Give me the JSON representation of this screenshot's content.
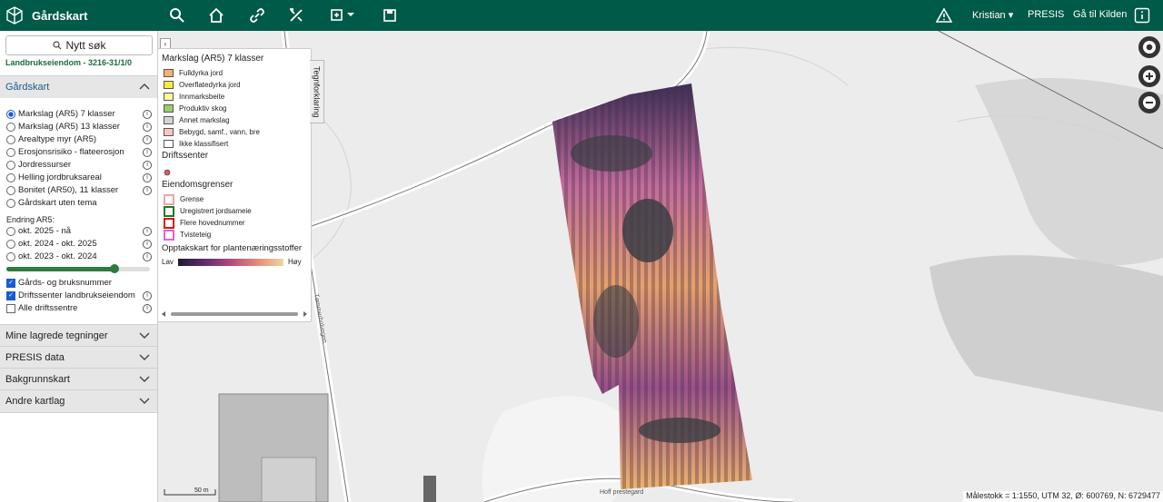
{
  "app": {
    "title": "Gårdskart"
  },
  "topbar": {
    "icons": [
      "search-icon",
      "home-icon",
      "link-icon",
      "tools-icon",
      "add-layer-icon",
      "save-icon"
    ],
    "warning_icon": "warning-icon",
    "user_label": "Kristian",
    "presis_label": "PRESIS",
    "kilden_label": "Gå til Kilden",
    "info_icon": "info-icon"
  },
  "sidebar": {
    "search_label": "Nytt søk",
    "property_label": "Landbrukseiendom - 3216-31/1/0",
    "gardskart_section": "Gårdskart",
    "themes": [
      {
        "label": "Markslag (AR5) 7 klasser",
        "selected": true
      },
      {
        "label": "Markslag (AR5) 13 klasser",
        "selected": false
      },
      {
        "label": "Arealtype myr (AR5)",
        "selected": false
      },
      {
        "label": "Erosjonsrisiko - flateerosjon",
        "selected": false
      },
      {
        "label": "Jordressurser",
        "selected": false
      },
      {
        "label": "Helling jordbruksareal",
        "selected": false
      },
      {
        "label": "Bonitet (AR50), 11 klasser",
        "selected": false
      },
      {
        "label": "Gårdskart uten tema",
        "selected": false
      }
    ],
    "endring_label": "Endring AR5:",
    "endring_options": [
      {
        "label": "okt. 2025 - nå",
        "selected": false
      },
      {
        "label": "okt. 2024 - okt. 2025",
        "selected": false
      },
      {
        "label": "okt. 2023 - okt. 2024",
        "selected": false
      }
    ],
    "slider_level": 0.75,
    "checkboxes": [
      {
        "label": "Gårds- og bruksnummer",
        "checked": true
      },
      {
        "label": "Driftssenter landbrukseiendom",
        "checked": true
      },
      {
        "label": "Alle driftssentre",
        "checked": false
      }
    ],
    "sections": [
      {
        "label": "Mine lagrede tegninger"
      },
      {
        "label": "PRESIS data"
      },
      {
        "label": "Bakgrunnskart"
      },
      {
        "label": "Andre kartlag"
      }
    ]
  },
  "legend": {
    "tab_label": "Tegnforklaring",
    "markslag_title": "Markslag (AR5) 7 klasser",
    "markslag_items": [
      {
        "label": "Fulldyrka jord",
        "color": "#f5b26b"
      },
      {
        "label": "Overflatedyrka jord",
        "color": "#ffea3a"
      },
      {
        "label": "Innmarksbeite",
        "color": "#fffaa0"
      },
      {
        "label": "Produktiv skog",
        "color": "#9acd6e"
      },
      {
        "label": "Annet markslag",
        "color": "#d4d4d4"
      },
      {
        "label": "Bebygd, samf., vann, bre",
        "color": "#f4c8c0"
      },
      {
        "label": "Ikke klassifisert",
        "color": "#ffffff"
      }
    ],
    "driftssenter_title": "Driftssenter",
    "driftssenter_color": "#e05a5a",
    "eiendom_title": "Eiendomsgrenser",
    "eiendom_items": [
      {
        "label": "Grense",
        "color": "#f2a3a3"
      },
      {
        "label": "Uregistrert jordsameie",
        "color": "#1d7a2a"
      },
      {
        "label": "Flere hovednummer",
        "color": "#e01010"
      },
      {
        "label": "Tvisteteig",
        "color": "#e060e0"
      }
    ],
    "opptak_title": "Opptakskart for plantenæringsstoffer",
    "low_label": "Lav",
    "high_label": "Høy"
  },
  "map": {
    "road_label_1": "Tømmerholvegen",
    "road_label_2": "Hoff prestegard",
    "scale_label": "50 m",
    "status": "Målestokk = 1:1550, UTM 32, Ø: 600769, N: 6729477"
  }
}
